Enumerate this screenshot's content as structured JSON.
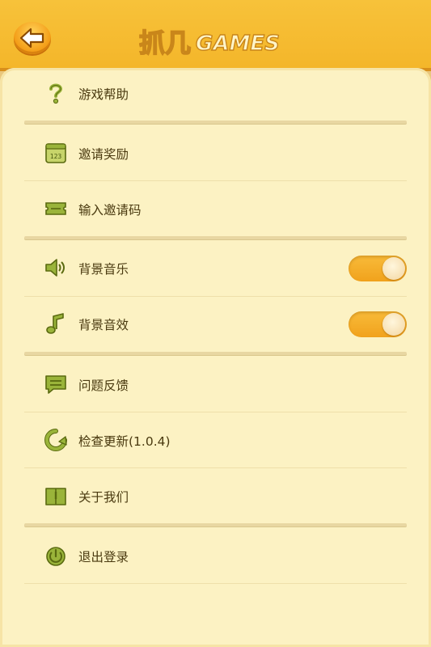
{
  "header": {
    "back_icon": "back-arrow-icon",
    "logo_main": "抓几",
    "logo_suffix": "GAMES",
    "colors": {
      "bar": "#f4b62a",
      "border": "#d88f1b"
    }
  },
  "menu": {
    "help": {
      "label": "游戏帮助",
      "icon": "question-icon"
    },
    "invite_reward": {
      "label": "邀请奖励",
      "icon": "calendar-123-icon"
    },
    "enter_invite": {
      "label": "输入邀请码",
      "icon": "ticket-icon"
    },
    "bg_music": {
      "label": "背景音乐",
      "icon": "speaker-icon",
      "enabled": true
    },
    "bg_sound": {
      "label": "背景音效",
      "icon": "music-note-icon",
      "enabled": true
    },
    "feedback": {
      "label": "问题反馈",
      "icon": "message-icon"
    },
    "update": {
      "label": "检查更新(1.0.4)",
      "icon": "refresh-icon"
    },
    "about": {
      "label": "关于我们",
      "icon": "book-icon"
    },
    "logout": {
      "label": "退出登录",
      "icon": "power-icon"
    }
  },
  "colors": {
    "panel": "#fcf2c3",
    "accent": "#f4b62a",
    "icon_green": "#9ab43a",
    "text": "#4a3a10"
  }
}
